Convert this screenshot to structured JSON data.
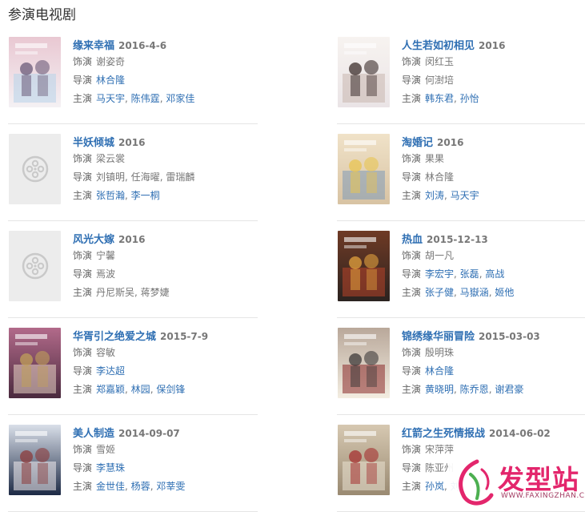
{
  "section": {
    "title": "参演电视剧"
  },
  "labels": {
    "role": "饰演",
    "director": "导演",
    "cast": "主演"
  },
  "colors": {
    "link": "#2f6fb3",
    "text": "#777777",
    "watermark": "#e3266c"
  },
  "works": [
    {
      "title": "缘来幸福",
      "date": "2016-4-6",
      "has_poster": true,
      "role": "谢姿奇",
      "director": [
        "林合隆"
      ],
      "director_linked": true,
      "cast": [
        "马天宇",
        "陈伟霆",
        "邓家佳"
      ],
      "cast_linked": true
    },
    {
      "title": "人生若如初相见",
      "date": "2016",
      "has_poster": true,
      "role": "闵红玉",
      "director": [
        "何澍培"
      ],
      "director_linked": false,
      "cast": [
        "韩东君",
        "孙怡"
      ],
      "cast_linked": true
    },
    {
      "title": "半妖倾城",
      "date": "2016",
      "has_poster": false,
      "role": "梁云裳",
      "director": [
        "刘镇明",
        "任海曜",
        "雷瑞麟"
      ],
      "director_linked": false,
      "cast": [
        "张哲瀚",
        "李一桐"
      ],
      "cast_linked": true
    },
    {
      "title": "淘婚记",
      "date": "2016",
      "has_poster": true,
      "role": "果果",
      "director": [
        "林合隆"
      ],
      "director_linked": false,
      "cast": [
        "刘涛",
        "马天宇"
      ],
      "cast_linked": true
    },
    {
      "title": "风光大嫁",
      "date": "2016",
      "has_poster": false,
      "role": "宁馨",
      "director": [
        "焉波"
      ],
      "director_linked": false,
      "cast": [
        "丹尼斯吴",
        "蒋梦婕"
      ],
      "cast_linked": false
    },
    {
      "title": "热血",
      "date": "2015-12-13",
      "has_poster": true,
      "role": "胡一凡",
      "director": [
        "李宏宇",
        "张磊",
        "高战"
      ],
      "director_linked": true,
      "cast": [
        "张子健",
        "马嶽涵",
        "姬他"
      ],
      "cast_linked": true
    },
    {
      "title": "华胥引之绝爱之城",
      "date": "2015-7-9",
      "has_poster": true,
      "role": "容敏",
      "director": [
        "李达超"
      ],
      "director_linked": true,
      "cast": [
        "郑嘉颖",
        "林园",
        "保剑锋"
      ],
      "cast_linked": true
    },
    {
      "title": "锦绣缘华丽冒险",
      "date": "2015-03-03",
      "has_poster": true,
      "role": "殷明珠",
      "director": [
        "林合隆"
      ],
      "director_linked": true,
      "cast": [
        "黄晓明",
        "陈乔恩",
        "谢君豪"
      ],
      "cast_linked": true
    },
    {
      "title": "美人制造",
      "date": "2014-09-07",
      "has_poster": true,
      "role": "雪姬",
      "director": [
        "李慧珠"
      ],
      "director_linked": true,
      "cast": [
        "金世佳",
        "杨蓉",
        "邓莘雯"
      ],
      "cast_linked": true
    },
    {
      "title": "红箭之生死情报战",
      "date": "2014-06-02",
      "has_poster": true,
      "role": "宋萍萍",
      "director": [
        "陈亚州"
      ],
      "director_linked": false,
      "cast": [
        "孙岚",
        "刘"
      ],
      "cast_linked": true
    }
  ],
  "watermark": {
    "text": "发型站",
    "url": "WWW.FAXINGZHAN.COM"
  }
}
